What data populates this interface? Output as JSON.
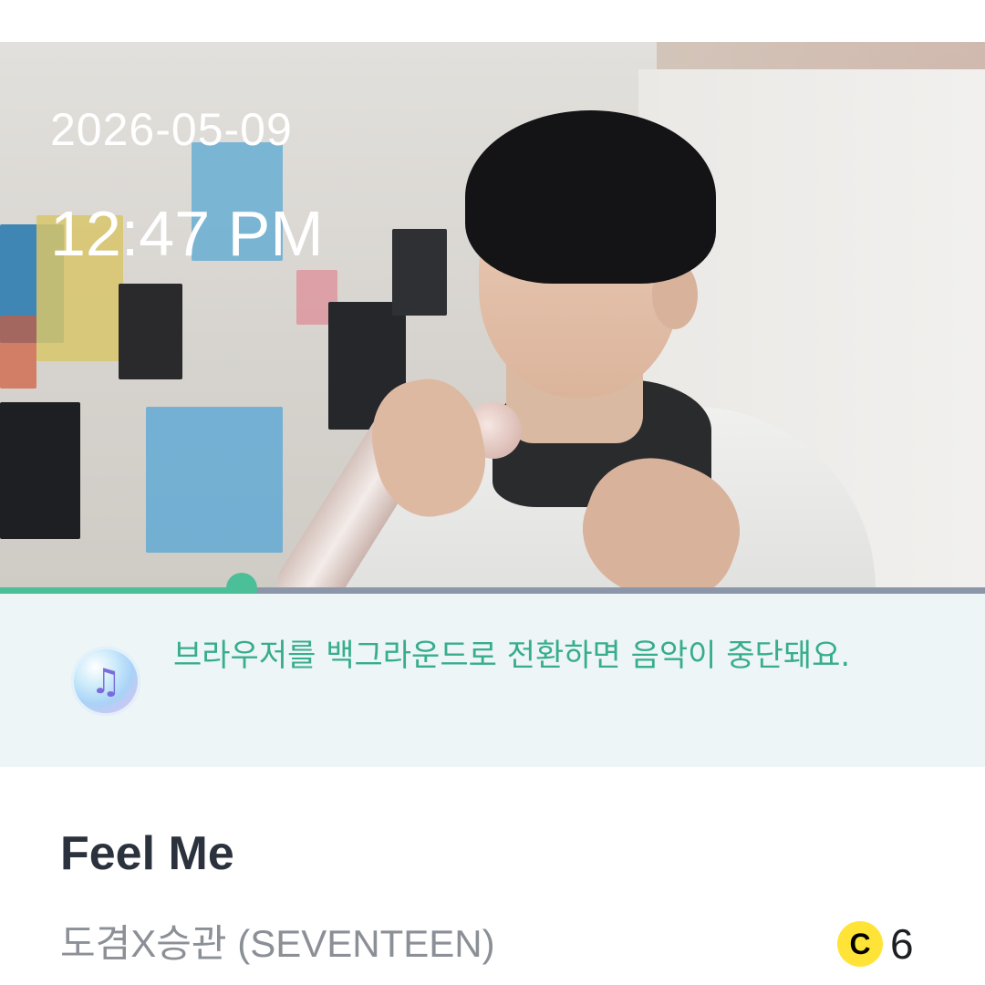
{
  "status": {
    "date": "2026-05-09",
    "time": "12:47 PM"
  },
  "player": {
    "progress_fraction": 0.245,
    "accent_color": "#4bbf97",
    "track_color": "#8c96a9"
  },
  "notice": {
    "icon": "music-note-icon",
    "text": "브라우저를 백그라운드로 전환하면 음악이 중단돼요."
  },
  "song": {
    "title": "Feel Me",
    "artist": "도겸X승관 (SEVENTEEN)",
    "credit_icon_label": "C",
    "credit_count": "6"
  }
}
